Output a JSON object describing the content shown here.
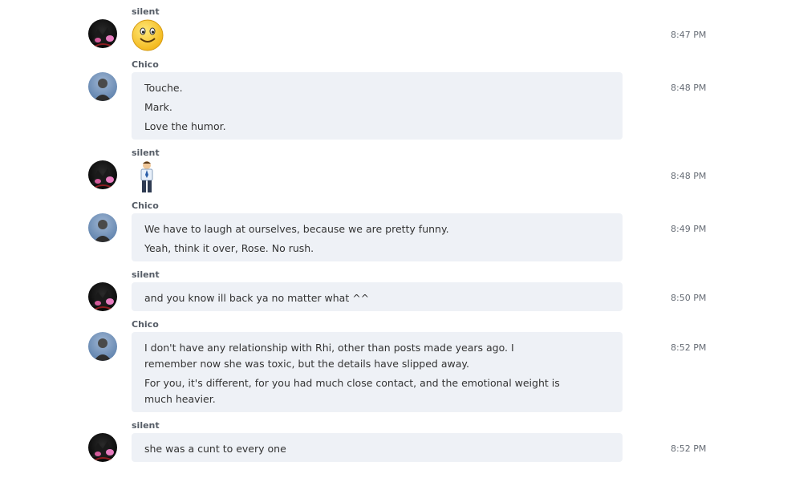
{
  "messages": [
    {
      "sender": "silent",
      "time": "8:47 PM",
      "type": "emoji",
      "emoji": "smile-emoji"
    },
    {
      "sender": "Chico",
      "time": "8:48 PM",
      "type": "text",
      "lines": [
        "Touche.",
        "Mark.",
        "Love the humor."
      ]
    },
    {
      "sender": "silent",
      "time": "8:48 PM",
      "type": "emoji",
      "emoji": "man-standing-emoji"
    },
    {
      "sender": "Chico",
      "time": "8:49 PM",
      "type": "text",
      "lines": [
        "We have to laugh at ourselves, because we are pretty funny.",
        "Yeah, think it over, Rose.  No rush."
      ]
    },
    {
      "sender": "silent",
      "time": "8:50 PM",
      "type": "text",
      "lines": [
        "and you know ill back ya no matter what ^^"
      ]
    },
    {
      "sender": "Chico",
      "time": "8:52 PM",
      "type": "text",
      "lines": [
        "I don't have any relationship with Rhi, other than posts made years ago.  I remember now she was toxic, but the details have slipped away.",
        "For you, it's different, for you had much close contact, and the emotional weight is much heavier."
      ]
    },
    {
      "sender": "silent",
      "time": "8:52 PM",
      "type": "text",
      "lines": [
        "she was a cunt to every one"
      ]
    }
  ],
  "colors": {
    "bubble": "#eef1f6",
    "sender": "#555c66",
    "time": "#666c75"
  }
}
